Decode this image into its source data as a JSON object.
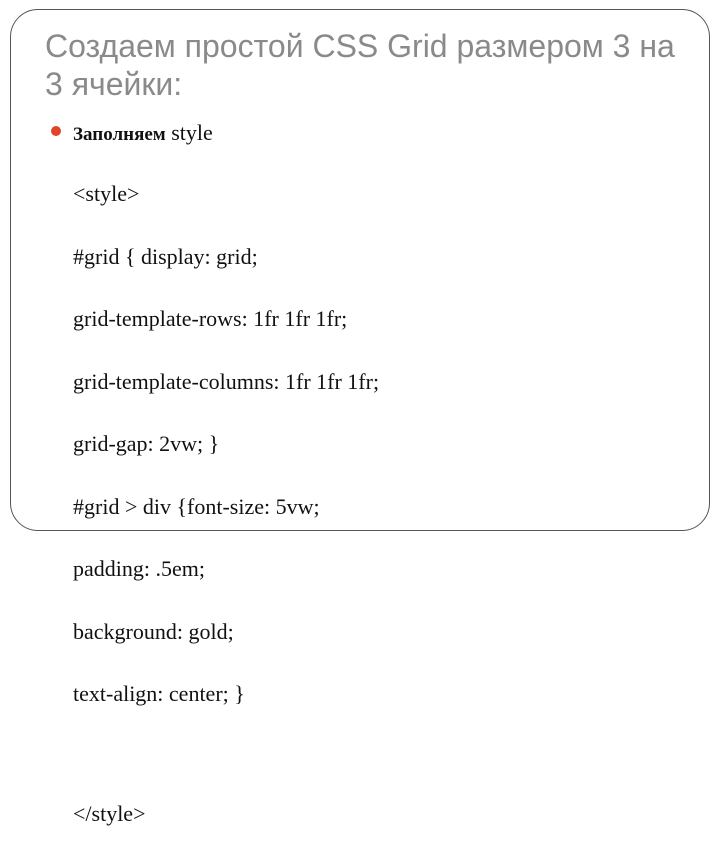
{
  "title": "Создаем простой CSS Grid размером 3 на 3 ячейки:",
  "bullet": {
    "lead_bold": "Заполняем",
    "lead_rest": " style",
    "code_lines": [
      "<style>",
      "#grid { display: grid;",
      "grid-template-rows: 1fr 1fr 1fr;",
      "grid-template-columns: 1fr 1fr 1fr;",
      "grid-gap: 2vw; }",
      "#grid > div {font-size: 5vw;",
      "padding: .5em;",
      "background: gold;",
      "text-align: center; }"
    ],
    "code_close": "</style>"
  }
}
